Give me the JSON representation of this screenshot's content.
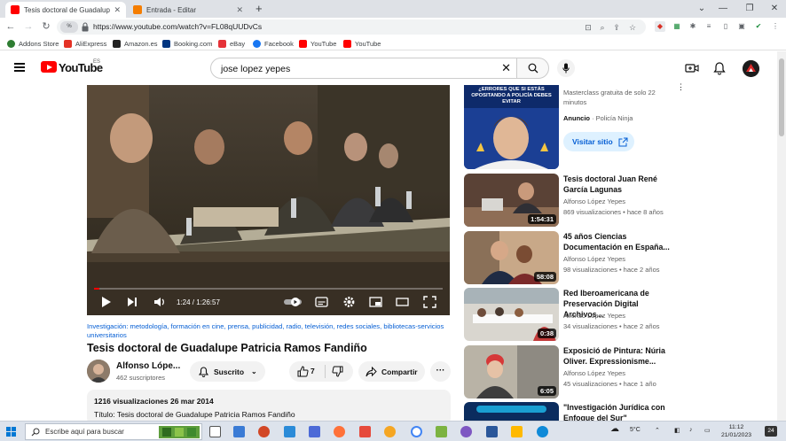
{
  "browser": {
    "tabs": [
      {
        "label": "Tesis doctoral de Guadalupe Patri...",
        "icon": "youtube-favicon",
        "active": true
      },
      {
        "label": "Entrada - Editar",
        "icon": "blogger-favicon",
        "active": false
      }
    ],
    "url": "https://www.youtube.com/watch?v=FL08qUUDvCs",
    "site_chip": "%"
  },
  "bookmarks": [
    {
      "label": "Addons Store",
      "icon": "addons-icon",
      "color": "#2e7d32"
    },
    {
      "label": "AliExpress",
      "icon": "aliexpress-icon",
      "color": "#e43225"
    },
    {
      "label": "Amazon.es",
      "icon": "amazon-icon",
      "color": "#222222"
    },
    {
      "label": "Booking.com",
      "icon": "booking-icon",
      "color": "#003580"
    },
    {
      "label": "eBay",
      "icon": "ebay-icon",
      "color": "#e53238"
    },
    {
      "label": "Facebook",
      "icon": "facebook-icon",
      "color": "#1877f2"
    },
    {
      "label": "YouTube",
      "icon": "youtube-icon",
      "color": "#ff0000"
    },
    {
      "label": "YouTube",
      "icon": "youtube-icon",
      "color": "#ff0000"
    }
  ],
  "youtube": {
    "logo_text": "YouTube",
    "region": "ES",
    "search_query": "jose lopez yepes"
  },
  "player": {
    "current_time": "1:24",
    "duration": "1:26:57",
    "time_display": "1:24 / 1:26:57",
    "progress_fraction": 0.016
  },
  "video": {
    "tags": "Investigación: metodología, formación en cine, prensa, publicidad, radio, televisión, redes sociales, bibliotecas-servicios universitarios",
    "title": "Tesis doctoral de Guadalupe Patricia Ramos Fandiño",
    "channel": "Alfonso Lópe...",
    "subscribers": "462 suscriptores",
    "subscribe_label": "Suscrito",
    "likes": "7",
    "share_label": "Compartir",
    "stats": "1216 visualizaciones  26 mar 2014",
    "desc_title": "Título: Tesis doctoral de Guadalupe Patricia Ramos Fandiño"
  },
  "ad": {
    "thumb_text": "¿ERRORES QUE SI ESTÁS OPOSITANDO A POLICÍA DEBES EVITAR",
    "description": "Masterclass gratuita de solo 22 minutos",
    "label": "Anuncio",
    "advertiser": "· Policía Ninja",
    "cta": "Visitar sitio"
  },
  "recommendations": [
    {
      "title": "Tesis doctoral Juan René García Lagunas",
      "channel": "Alfonso López Yepes",
      "meta": "869 visualizaciones  • hace 8 años",
      "duration": "1:54:31"
    },
    {
      "title": "45 años Ciencias Documentación en España...",
      "channel": "Alfonso López Yepes",
      "meta": "98 visualizaciones  • hace 2 años",
      "duration": "58:08"
    },
    {
      "title": "Red Iberoamericana de Preservación Digital Archivos...",
      "channel": "Alfonso López Yepes",
      "meta": "34 visualizaciones  • hace 2 años",
      "duration": "0:38"
    },
    {
      "title": "Exposició de Pintura: Núria Oliver. Expressionisme...",
      "channel": "Alfonso López Yepes",
      "meta": "45 visualizaciones  • hace 1 año",
      "duration": "6:05"
    },
    {
      "title": "\"Investigación Jurídica con Enfoque del Sur\"",
      "channel": "",
      "meta": "",
      "duration": ""
    }
  ],
  "taskbar": {
    "search_placeholder": "Escribe aquí para buscar",
    "temperature": "5°C",
    "time": "11:12",
    "date": "21/01/2023",
    "notifications": "24"
  }
}
